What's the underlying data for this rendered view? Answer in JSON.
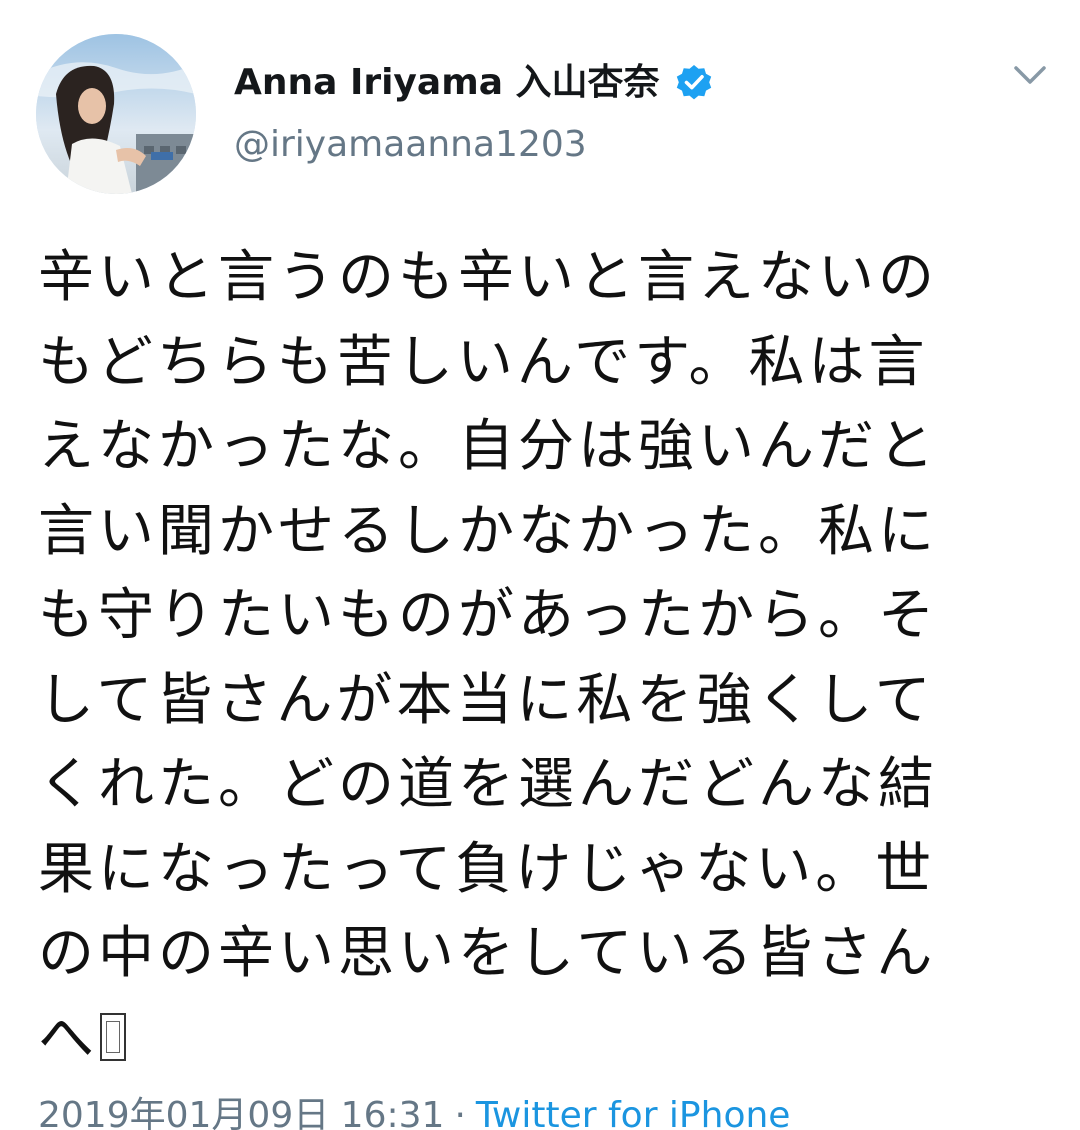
{
  "tweet": {
    "author": {
      "display_name": "Anna Iriyama 入山杏奈",
      "handle": "@iriyamaanna1203",
      "verified": true
    },
    "text_lines": [
      "辛いと言うのも辛いと言えないの",
      "もどちらも苦しいんです。私は言",
      "えなかったな。自分は強いんだと",
      "言い聞かせるしかなかった。私に",
      "も守りたいものがあったから。そ",
      "して皆さんが本当に私を強くして",
      "くれた。どの道を選んだどんな結",
      "果になったって負けじゃない。世",
      "の中の辛い思いをしている皆さん",
      "へ"
    ],
    "trailing_glyph": "unrendered-emoji-box",
    "timestamp": "2019年01月09日 16:31",
    "separator": "·",
    "source": "Twitter for iPhone"
  },
  "icons": {
    "verified": "verified-badge-icon",
    "menu": "chevron-down-icon"
  },
  "colors": {
    "text": "#14171a",
    "secondary": "#657786",
    "link": "#1b95e0",
    "verified": "#1da1f2"
  }
}
